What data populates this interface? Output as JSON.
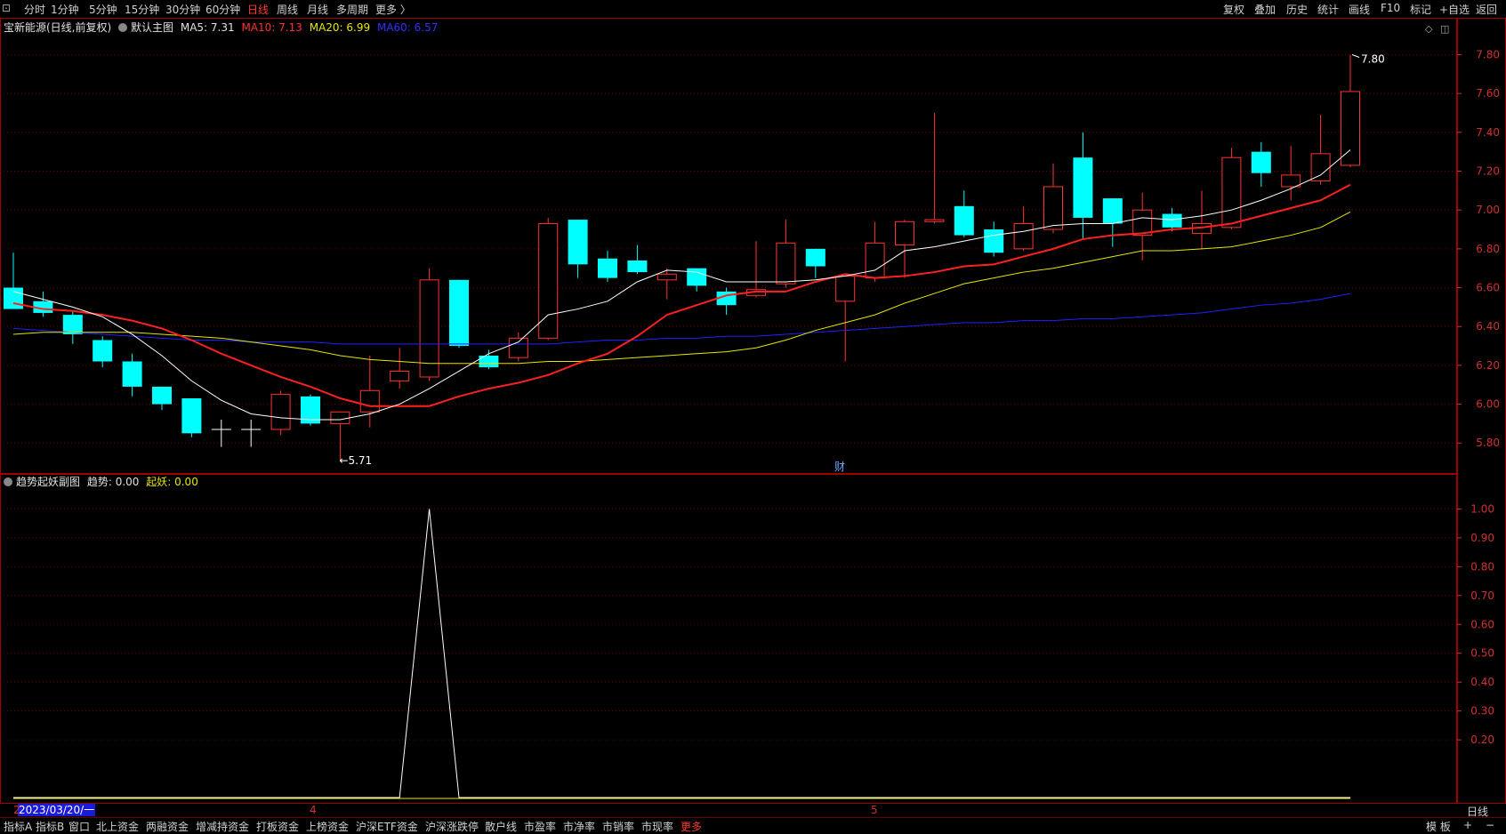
{
  "toolbar": {
    "left_items": [
      "分时",
      "1分钟",
      "5分钟",
      "15分钟",
      "30分钟",
      "60分钟",
      "日线",
      "周线",
      "月线",
      "多周期",
      "更多 〉"
    ],
    "active_index": 6,
    "right_items": [
      "复权",
      "叠加",
      "历史",
      "统计",
      "画线",
      "F10",
      "标记",
      "+自选",
      "返回"
    ]
  },
  "main_pane": {
    "stock_label": "宝新能源(日线,前复权)",
    "chart_label": "默认主图",
    "ma5_label": "MA5: 7.31",
    "ma10_label": "MA10: 7.13",
    "ma20_label": "MA20: 6.99",
    "ma60_label": "MA60: 6.57",
    "high_marker": "7.80",
    "low_marker": "5.71",
    "fin_marker": "财"
  },
  "sub_pane": {
    "title": "趋势起妖副图",
    "trend_label": "趋势: 0.00",
    "qiyao_label": "起妖: 0.00"
  },
  "colors": {
    "up": "#ff3232",
    "down": "#00ffff",
    "ma5": "#ffffff",
    "ma10": "#ff2020",
    "ma20": "#e6e600",
    "ma60": "#2020ff",
    "grid": "#6a0000",
    "axis": "#d03030"
  },
  "chart_data": [
    {
      "type": "candlestick",
      "ylim": [
        5.65,
        7.88
      ],
      "yticks": [
        "7.80",
        "7.60",
        "7.40",
        "7.20",
        "7.00",
        "6.80",
        "6.60",
        "6.40",
        "6.20",
        "6.00",
        "5.80"
      ],
      "candles": [
        {
          "o": 6.6,
          "h": 6.78,
          "l": 6.49,
          "c": 6.49
        },
        {
          "o": 6.53,
          "h": 6.58,
          "l": 6.45,
          "c": 6.47
        },
        {
          "o": 6.46,
          "h": 6.48,
          "l": 6.31,
          "c": 6.36
        },
        {
          "o": 6.33,
          "h": 6.35,
          "l": 6.19,
          "c": 6.22
        },
        {
          "o": 6.22,
          "h": 6.26,
          "l": 6.04,
          "c": 6.09
        },
        {
          "o": 6.09,
          "h": 6.09,
          "l": 5.97,
          "c": 6.0
        },
        {
          "o": 6.03,
          "h": 6.03,
          "l": 5.83,
          "c": 5.85
        },
        {
          "o": 5.87,
          "h": 5.92,
          "l": 5.78,
          "c": 5.87
        },
        {
          "o": 5.87,
          "h": 5.92,
          "l": 5.78,
          "c": 5.87
        },
        {
          "o": 5.87,
          "h": 6.07,
          "l": 5.84,
          "c": 6.05
        },
        {
          "o": 6.04,
          "h": 6.05,
          "l": 5.89,
          "c": 5.9
        },
        {
          "o": 5.9,
          "h": 5.96,
          "l": 5.71,
          "c": 5.96
        },
        {
          "o": 5.96,
          "h": 6.25,
          "l": 5.88,
          "c": 6.07
        },
        {
          "o": 6.12,
          "h": 6.29,
          "l": 6.08,
          "c": 6.17
        },
        {
          "o": 6.14,
          "h": 6.7,
          "l": 6.12,
          "c": 6.64
        },
        {
          "o": 6.64,
          "h": 6.64,
          "l": 6.29,
          "c": 6.3
        },
        {
          "o": 6.25,
          "h": 6.28,
          "l": 6.18,
          "c": 6.19
        },
        {
          "o": 6.24,
          "h": 6.37,
          "l": 6.22,
          "c": 6.34
        },
        {
          "o": 6.34,
          "h": 6.96,
          "l": 6.33,
          "c": 6.93
        },
        {
          "o": 6.95,
          "h": 6.95,
          "l": 6.65,
          "c": 6.72
        },
        {
          "o": 6.75,
          "h": 6.79,
          "l": 6.63,
          "c": 6.65
        },
        {
          "o": 6.74,
          "h": 6.82,
          "l": 6.67,
          "c": 6.68
        },
        {
          "o": 6.64,
          "h": 6.7,
          "l": 6.54,
          "c": 6.67
        },
        {
          "o": 6.7,
          "h": 6.7,
          "l": 6.58,
          "c": 6.61
        },
        {
          "o": 6.58,
          "h": 6.6,
          "l": 6.46,
          "c": 6.51
        },
        {
          "o": 6.56,
          "h": 6.84,
          "l": 6.55,
          "c": 6.59
        },
        {
          "o": 6.62,
          "h": 6.95,
          "l": 6.6,
          "c": 6.83
        },
        {
          "o": 6.8,
          "h": 6.8,
          "l": 6.65,
          "c": 6.71
        },
        {
          "o": 6.53,
          "h": 6.66,
          "l": 6.22,
          "c": 6.66
        },
        {
          "o": 6.65,
          "h": 6.94,
          "l": 6.63,
          "c": 6.83
        },
        {
          "o": 6.82,
          "h": 6.95,
          "l": 6.65,
          "c": 6.94
        },
        {
          "o": 6.94,
          "h": 7.5,
          "l": 6.93,
          "c": 6.95
        },
        {
          "o": 7.02,
          "h": 7.1,
          "l": 6.86,
          "c": 6.87
        },
        {
          "o": 6.9,
          "h": 6.94,
          "l": 6.76,
          "c": 6.78
        },
        {
          "o": 6.8,
          "h": 7.02,
          "l": 6.79,
          "c": 6.93
        },
        {
          "o": 6.9,
          "h": 7.24,
          "l": 6.88,
          "c": 7.12
        },
        {
          "o": 7.27,
          "h": 7.4,
          "l": 6.85,
          "c": 6.96
        },
        {
          "o": 7.06,
          "h": 7.06,
          "l": 6.81,
          "c": 6.93
        },
        {
          "o": 6.87,
          "h": 7.09,
          "l": 6.74,
          "c": 7.0
        },
        {
          "o": 6.98,
          "h": 7.01,
          "l": 6.89,
          "c": 6.91
        },
        {
          "o": 6.88,
          "h": 7.1,
          "l": 6.8,
          "c": 6.93
        },
        {
          "o": 6.91,
          "h": 7.32,
          "l": 6.9,
          "c": 7.27
        },
        {
          "o": 7.3,
          "h": 7.35,
          "l": 7.12,
          "c": 7.19
        },
        {
          "o": 7.12,
          "h": 7.33,
          "l": 7.05,
          "c": 7.18
        },
        {
          "o": 7.15,
          "h": 7.49,
          "l": 7.13,
          "c": 7.29
        },
        {
          "o": 7.23,
          "h": 7.8,
          "l": 7.22,
          "c": 7.61
        }
      ],
      "ma5": [
        6.58,
        6.54,
        6.5,
        6.45,
        6.36,
        6.25,
        6.12,
        6.02,
        5.95,
        5.93,
        5.92,
        5.92,
        5.95,
        6.0,
        6.08,
        6.17,
        6.26,
        6.32,
        6.46,
        6.49,
        6.53,
        6.63,
        6.69,
        6.68,
        6.63,
        6.63,
        6.63,
        6.64,
        6.66,
        6.69,
        6.79,
        6.81,
        6.84,
        6.87,
        6.89,
        6.92,
        6.93,
        6.93,
        6.96,
        6.95,
        6.97,
        7.0,
        7.05,
        7.11,
        7.18,
        7.31
      ],
      "ma10": [
        6.52,
        6.49,
        6.48,
        6.46,
        6.43,
        6.39,
        6.33,
        6.26,
        6.2,
        6.14,
        6.09,
        6.03,
        5.99,
        5.99,
        5.99,
        6.04,
        6.08,
        6.11,
        6.15,
        6.21,
        6.26,
        6.35,
        6.46,
        6.51,
        6.56,
        6.58,
        6.58,
        6.63,
        6.67,
        6.65,
        6.66,
        6.68,
        6.71,
        6.72,
        6.76,
        6.8,
        6.85,
        6.87,
        6.88,
        6.9,
        6.91,
        6.93,
        6.97,
        7.01,
        7.05,
        7.13
      ],
      "ma20": [
        6.36,
        6.37,
        6.37,
        6.37,
        6.37,
        6.36,
        6.35,
        6.34,
        6.32,
        6.3,
        6.28,
        6.25,
        6.23,
        6.22,
        6.21,
        6.21,
        6.21,
        6.21,
        6.22,
        6.22,
        6.23,
        6.24,
        6.25,
        6.26,
        6.27,
        6.29,
        6.33,
        6.38,
        6.42,
        6.46,
        6.52,
        6.57,
        6.62,
        6.65,
        6.68,
        6.7,
        6.73,
        6.76,
        6.79,
        6.79,
        6.8,
        6.81,
        6.84,
        6.87,
        6.91,
        6.99
      ],
      "ma60": [
        6.39,
        6.38,
        6.37,
        6.36,
        6.35,
        6.34,
        6.33,
        6.33,
        6.32,
        6.32,
        6.32,
        6.31,
        6.31,
        6.31,
        6.31,
        6.31,
        6.31,
        6.31,
        6.31,
        6.32,
        6.33,
        6.33,
        6.34,
        6.34,
        6.35,
        6.35,
        6.36,
        6.37,
        6.38,
        6.39,
        6.4,
        6.41,
        6.42,
        6.42,
        6.43,
        6.43,
        6.44,
        6.44,
        6.45,
        6.46,
        6.47,
        6.49,
        6.51,
        6.52,
        6.54,
        6.57
      ]
    },
    {
      "type": "line",
      "ylim": [
        0,
        1.06
      ],
      "yticks": [
        "1.00",
        "0.90",
        "0.80",
        "0.70",
        "0.60",
        "0.50",
        "0.40",
        "0.30",
        "0.20"
      ],
      "series": [
        {
          "name": "趋势",
          "values": [
            0,
            0,
            0,
            0,
            0,
            0,
            0,
            0,
            0,
            0,
            0,
            0,
            0,
            0,
            1,
            0,
            0,
            0,
            0,
            0,
            0,
            0,
            0,
            0,
            0,
            0,
            0,
            0,
            0,
            0,
            0,
            0,
            0,
            0,
            0,
            0,
            0,
            0,
            0,
            0,
            0,
            0,
            0,
            0,
            0,
            0
          ]
        },
        {
          "name": "起妖",
          "values": [
            0,
            0,
            0,
            0,
            0,
            0,
            0,
            0,
            0,
            0,
            0,
            0,
            0,
            0,
            0,
            0,
            0,
            0,
            0,
            0,
            0,
            0,
            0,
            0,
            0,
            0,
            0,
            0,
            0,
            0,
            0,
            0,
            0,
            0,
            0,
            0,
            0,
            0,
            0,
            0,
            0,
            0,
            0,
            0,
            0,
            0
          ]
        }
      ]
    }
  ],
  "x_axis": {
    "date_label": "2023/03/20/一",
    "month_marks": [
      "2",
      "4",
      "5"
    ]
  },
  "bottom_tabs": {
    "items": [
      "指标A",
      "指标B",
      "窗口",
      "北上资金",
      "两融资金",
      "增减持资金",
      "打板资金",
      "上榜资金",
      "沪深ETF资金",
      "沪深涨跌停",
      "散户线",
      "市盈率",
      "市净率",
      "市销率",
      "市现率",
      "更多"
    ],
    "active_index": 15,
    "right_items": [
      "模 板",
      "+",
      "−"
    ],
    "period_label": "日线"
  }
}
